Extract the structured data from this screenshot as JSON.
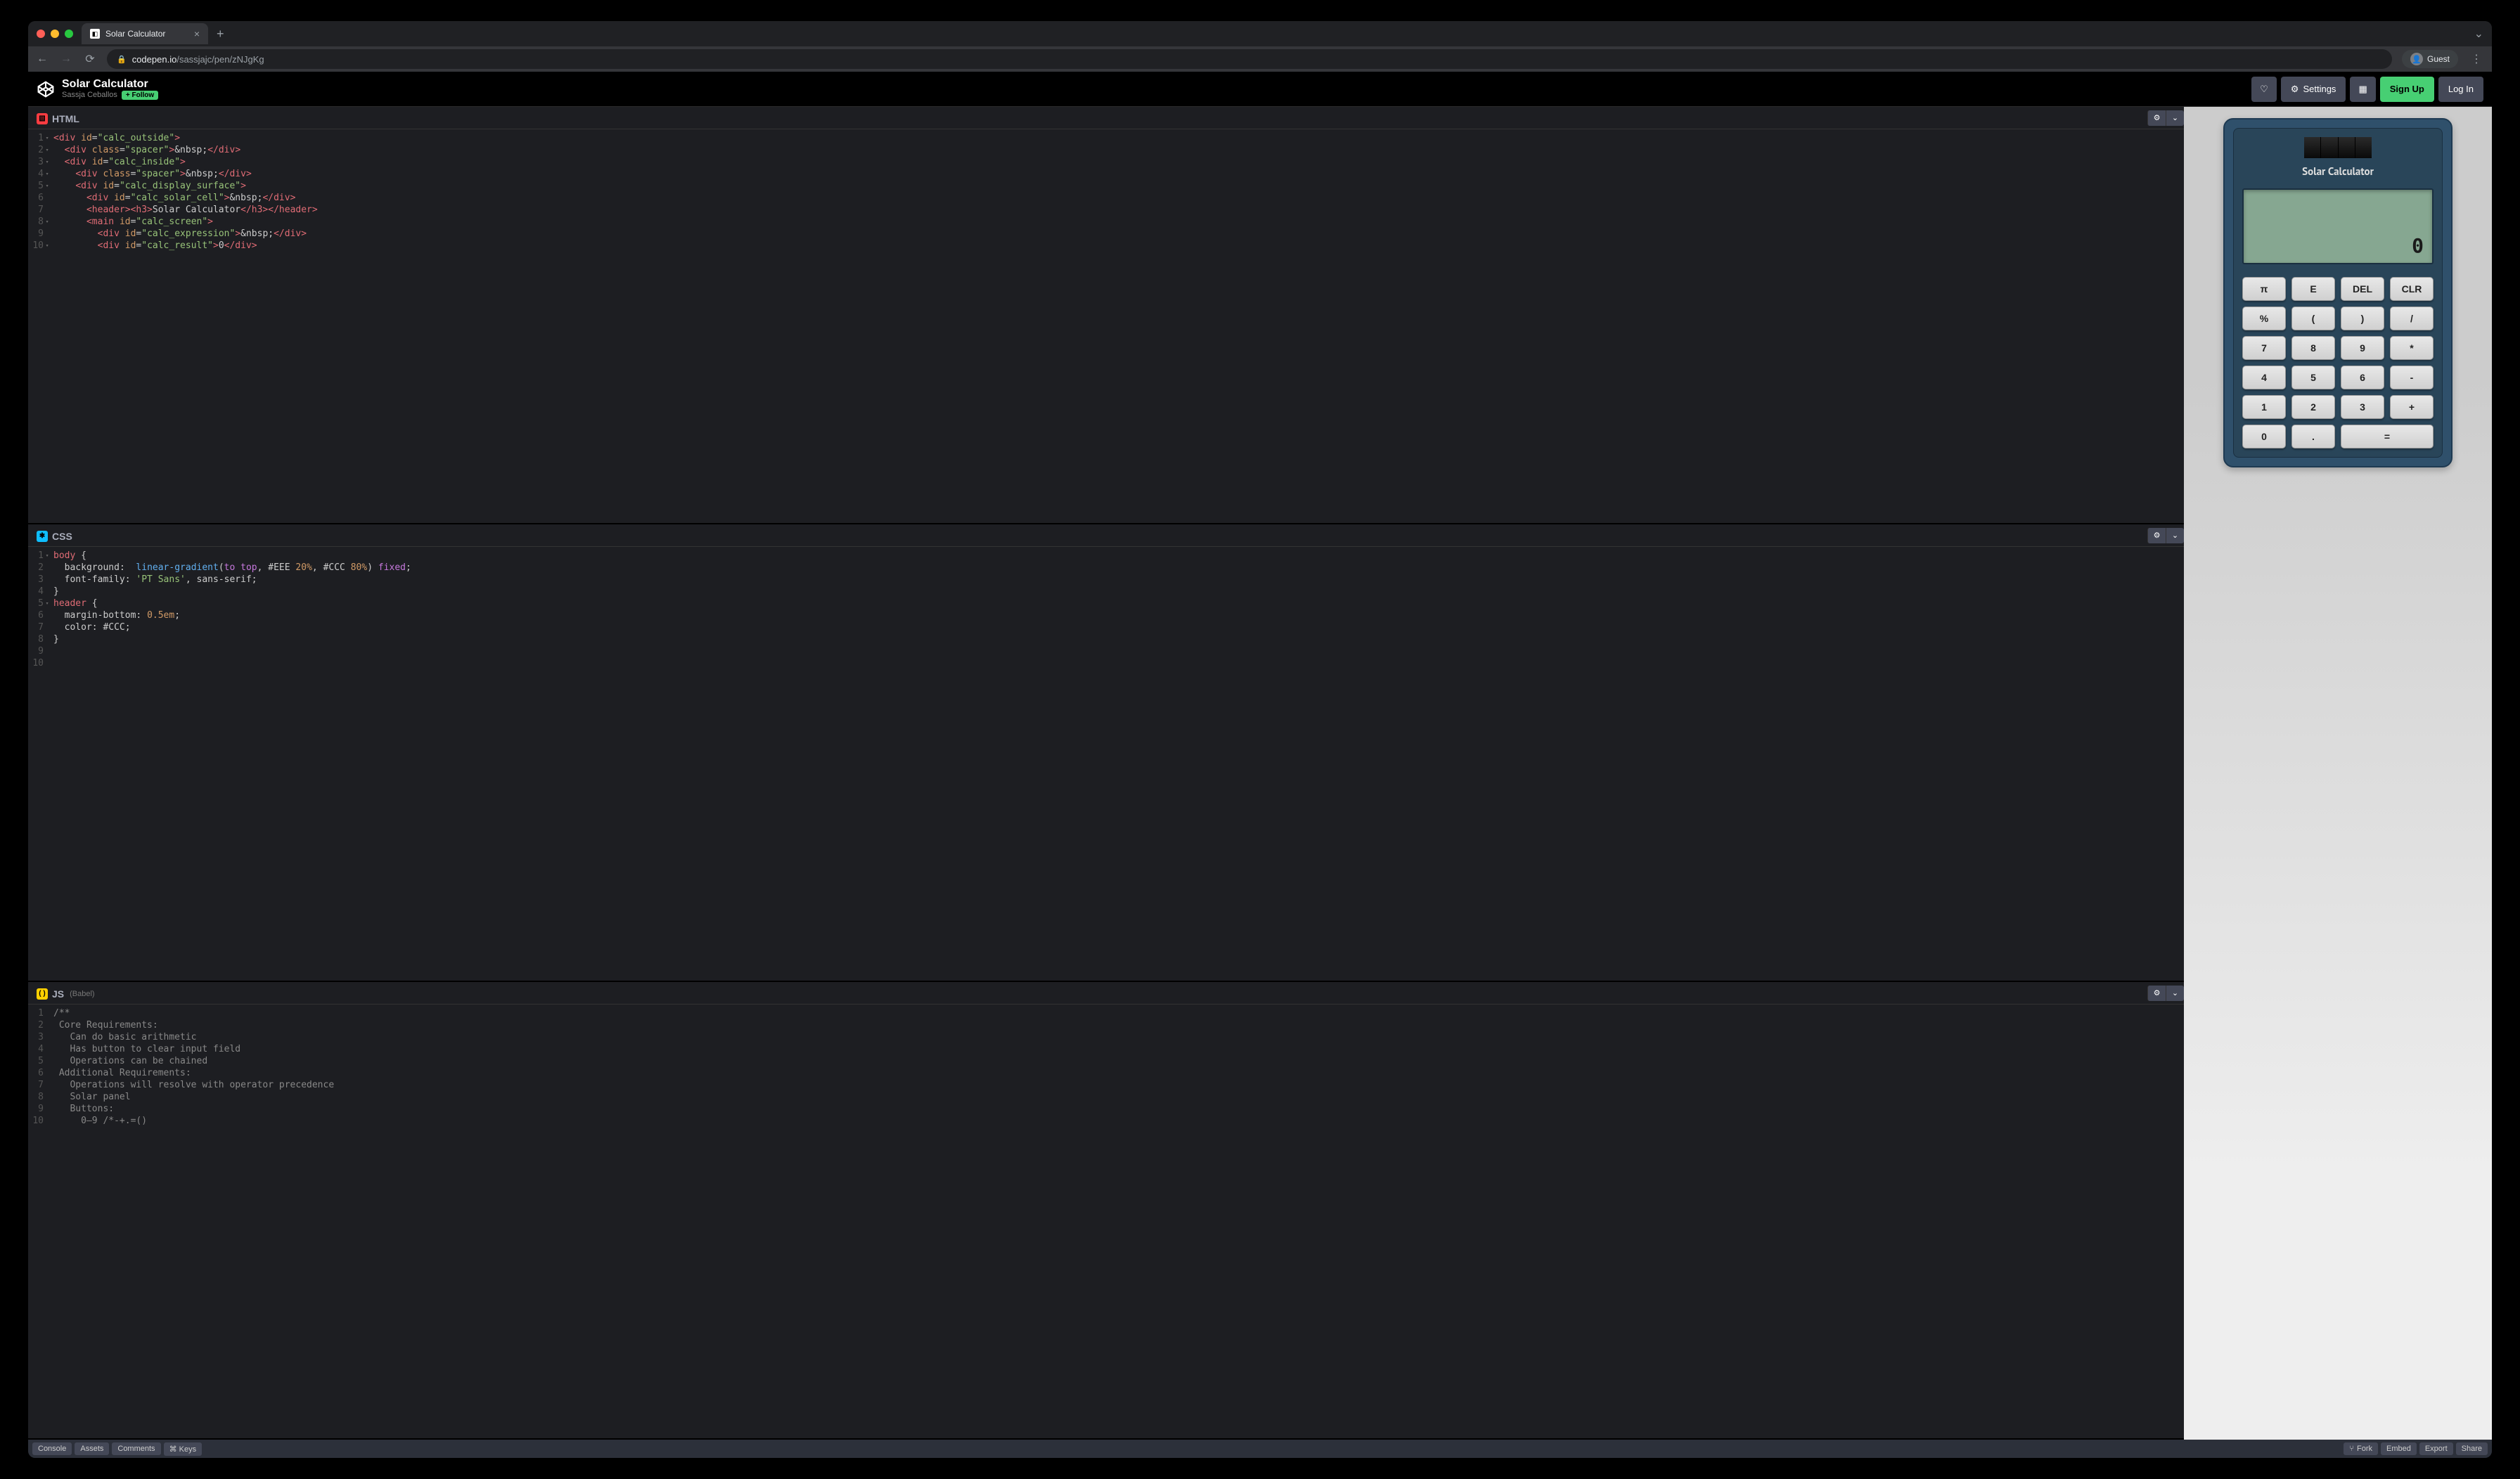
{
  "browser": {
    "tab_title": "Solar Calculator",
    "url_host": "codepen.io",
    "url_path": "/sassjajc/pen/zNJgKg",
    "guest_label": "Guest"
  },
  "codepen": {
    "title": "Solar Calculator",
    "author": "Sassja Ceballos",
    "follow_label": "+ Follow",
    "settings_label": "Settings",
    "signup_label": "Sign Up",
    "login_label": "Log In"
  },
  "editors": {
    "html": {
      "label": "HTML",
      "lines": [
        {
          "n": "1",
          "fold": true,
          "tokens": [
            [
              "tag",
              "<div "
            ],
            [
              "attr-n",
              "id"
            ],
            [
              "eq",
              "="
            ],
            [
              "str",
              "\"calc_outside\""
            ],
            [
              "tag",
              ">"
            ]
          ]
        },
        {
          "n": "2",
          "fold": true,
          "tokens": [
            [
              "txt",
              "  "
            ],
            [
              "tag",
              "<div "
            ],
            [
              "attr-n",
              "class"
            ],
            [
              "eq",
              "="
            ],
            [
              "str",
              "\"spacer\""
            ],
            [
              "tag",
              ">"
            ],
            [
              "txt",
              "&nbsp;"
            ],
            [
              "tag",
              "</div>"
            ]
          ]
        },
        {
          "n": "3",
          "fold": true,
          "tokens": [
            [
              "txt",
              "  "
            ],
            [
              "tag",
              "<div "
            ],
            [
              "attr-n",
              "id"
            ],
            [
              "eq",
              "="
            ],
            [
              "str",
              "\"calc_inside\""
            ],
            [
              "tag",
              ">"
            ]
          ]
        },
        {
          "n": "4",
          "fold": true,
          "tokens": [
            [
              "txt",
              "    "
            ],
            [
              "tag",
              "<div "
            ],
            [
              "attr-n",
              "class"
            ],
            [
              "eq",
              "="
            ],
            [
              "str",
              "\"spacer\""
            ],
            [
              "tag",
              ">"
            ],
            [
              "txt",
              "&nbsp;"
            ],
            [
              "tag",
              "</div>"
            ]
          ]
        },
        {
          "n": "5",
          "fold": true,
          "tokens": [
            [
              "txt",
              "    "
            ],
            [
              "tag",
              "<div "
            ],
            [
              "attr-n",
              "id"
            ],
            [
              "eq",
              "="
            ],
            [
              "str",
              "\"calc_display_surface\""
            ],
            [
              "tag",
              ">"
            ]
          ]
        },
        {
          "n": "6",
          "fold": false,
          "tokens": [
            [
              "txt",
              "      "
            ],
            [
              "tag",
              "<div "
            ],
            [
              "attr-n",
              "id"
            ],
            [
              "eq",
              "="
            ],
            [
              "str",
              "\"calc_solar_cell\""
            ],
            [
              "tag",
              ">"
            ],
            [
              "txt",
              "&nbsp;"
            ],
            [
              "tag",
              "</div>"
            ]
          ]
        },
        {
          "n": "7",
          "fold": false,
          "tokens": [
            [
              "txt",
              "      "
            ],
            [
              "tag",
              "<header><h3>"
            ],
            [
              "txt",
              "Solar Calculator"
            ],
            [
              "tag",
              "</h3></header>"
            ]
          ]
        },
        {
          "n": "8",
          "fold": true,
          "tokens": [
            [
              "txt",
              "      "
            ],
            [
              "tag",
              "<main "
            ],
            [
              "attr-n",
              "id"
            ],
            [
              "eq",
              "="
            ],
            [
              "str",
              "\"calc_screen\""
            ],
            [
              "tag",
              ">"
            ]
          ]
        },
        {
          "n": "9",
          "fold": false,
          "tokens": [
            [
              "txt",
              "        "
            ],
            [
              "tag",
              "<div "
            ],
            [
              "attr-n",
              "id"
            ],
            [
              "eq",
              "="
            ],
            [
              "str",
              "\"calc_expression\""
            ],
            [
              "tag",
              ">"
            ],
            [
              "txt",
              "&nbsp;"
            ],
            [
              "tag",
              "</div>"
            ]
          ]
        },
        {
          "n": "10",
          "fold": true,
          "tokens": [
            [
              "txt",
              "        "
            ],
            [
              "tag",
              "<div "
            ],
            [
              "attr-n",
              "id"
            ],
            [
              "eq",
              "="
            ],
            [
              "str",
              "\"calc_result\""
            ],
            [
              "tag",
              ">"
            ],
            [
              "txt",
              "0"
            ],
            [
              "tag",
              "</div>"
            ]
          ]
        }
      ]
    },
    "css": {
      "label": "CSS",
      "lines": [
        {
          "n": "1",
          "fold": true,
          "tokens": [
            [
              "sel",
              "body "
            ],
            [
              "txt",
              "{"
            ]
          ]
        },
        {
          "n": "2",
          "fold": false,
          "tokens": [
            [
              "txt",
              "  "
            ],
            [
              "prop",
              "background"
            ],
            [
              "txt",
              ":  "
            ],
            [
              "func",
              "linear-gradient"
            ],
            [
              "txt",
              "("
            ],
            [
              "kw",
              "to"
            ],
            [
              "txt",
              " "
            ],
            [
              "kw",
              "top"
            ],
            [
              "txt",
              ", "
            ],
            [
              "val",
              "#EEE "
            ],
            [
              "num",
              "20%"
            ],
            [
              "txt",
              ", "
            ],
            [
              "val",
              "#CCC "
            ],
            [
              "num",
              "80%"
            ],
            [
              "txt",
              ") "
            ],
            [
              "kw",
              "fixed"
            ],
            [
              "txt",
              ";"
            ]
          ]
        },
        {
          "n": "3",
          "fold": false,
          "tokens": [
            [
              "txt",
              "  "
            ],
            [
              "prop",
              "font-family"
            ],
            [
              "txt",
              ": "
            ],
            [
              "str",
              "'PT Sans'"
            ],
            [
              "txt",
              ", "
            ],
            [
              "val",
              "sans-serif"
            ],
            [
              "txt",
              ";"
            ]
          ]
        },
        {
          "n": "4",
          "fold": false,
          "tokens": [
            [
              "txt",
              "}"
            ]
          ]
        },
        {
          "n": "5",
          "fold": true,
          "tokens": [
            [
              "sel",
              "header "
            ],
            [
              "txt",
              "{"
            ]
          ]
        },
        {
          "n": "6",
          "fold": false,
          "tokens": [
            [
              "txt",
              "  "
            ],
            [
              "prop",
              "margin-bottom"
            ],
            [
              "txt",
              ": "
            ],
            [
              "num",
              "0.5em"
            ],
            [
              "txt",
              ";"
            ]
          ]
        },
        {
          "n": "7",
          "fold": false,
          "tokens": [
            [
              "txt",
              "  "
            ],
            [
              "prop",
              "color"
            ],
            [
              "txt",
              ": "
            ],
            [
              "val",
              "#CCC"
            ],
            [
              "txt",
              ";"
            ]
          ]
        },
        {
          "n": "8",
          "fold": false,
          "tokens": [
            [
              "txt",
              "}"
            ]
          ]
        },
        {
          "n": "9",
          "fold": false,
          "tokens": []
        },
        {
          "n": "10",
          "fold": false,
          "tokens": []
        }
      ]
    },
    "js": {
      "label": "JS",
      "sub": "(Babel)",
      "lines": [
        {
          "n": "1",
          "tokens": [
            [
              "cmt",
              "/**"
            ]
          ]
        },
        {
          "n": "2",
          "tokens": [
            [
              "cmt",
              " Core Requirements:"
            ]
          ]
        },
        {
          "n": "3",
          "tokens": [
            [
              "cmt",
              "   Can do basic arithmetic"
            ]
          ]
        },
        {
          "n": "4",
          "tokens": [
            [
              "cmt",
              "   Has button to clear input field"
            ]
          ]
        },
        {
          "n": "5",
          "tokens": [
            [
              "cmt",
              "   Operations can be chained"
            ]
          ]
        },
        {
          "n": "6",
          "tokens": [
            [
              "cmt",
              " Additional Requirements:"
            ]
          ]
        },
        {
          "n": "7",
          "tokens": [
            [
              "cmt",
              "   Operations will resolve with operator precedence"
            ]
          ]
        },
        {
          "n": "8",
          "tokens": [
            [
              "cmt",
              "   Solar panel"
            ]
          ]
        },
        {
          "n": "9",
          "tokens": [
            [
              "cmt",
              "   Buttons:"
            ]
          ]
        },
        {
          "n": "10",
          "tokens": [
            [
              "cmt",
              "     0–9 /*-+.=()"
            ]
          ]
        }
      ]
    }
  },
  "preview": {
    "title": "Solar Calculator",
    "result": "0",
    "buttons": [
      {
        "label": "π",
        "wide": false
      },
      {
        "label": "E",
        "wide": false
      },
      {
        "label": "DEL",
        "wide": false
      },
      {
        "label": "CLR",
        "wide": false
      },
      {
        "label": "%",
        "wide": false
      },
      {
        "label": "(",
        "wide": false
      },
      {
        "label": ")",
        "wide": false
      },
      {
        "label": "/",
        "wide": false
      },
      {
        "label": "7",
        "wide": false
      },
      {
        "label": "8",
        "wide": false
      },
      {
        "label": "9",
        "wide": false
      },
      {
        "label": "*",
        "wide": false
      },
      {
        "label": "4",
        "wide": false
      },
      {
        "label": "5",
        "wide": false
      },
      {
        "label": "6",
        "wide": false
      },
      {
        "label": "-",
        "wide": false
      },
      {
        "label": "1",
        "wide": false
      },
      {
        "label": "2",
        "wide": false
      },
      {
        "label": "3",
        "wide": false
      },
      {
        "label": "+",
        "wide": false
      },
      {
        "label": "0",
        "wide": false
      },
      {
        "label": ".",
        "wide": false
      },
      {
        "label": "=",
        "wide": true
      }
    ]
  },
  "footer": {
    "console": "Console",
    "assets": "Assets",
    "comments": "Comments",
    "keys": "⌘ Keys",
    "fork": "Fork",
    "embed": "Embed",
    "export": "Export",
    "share": "Share"
  }
}
